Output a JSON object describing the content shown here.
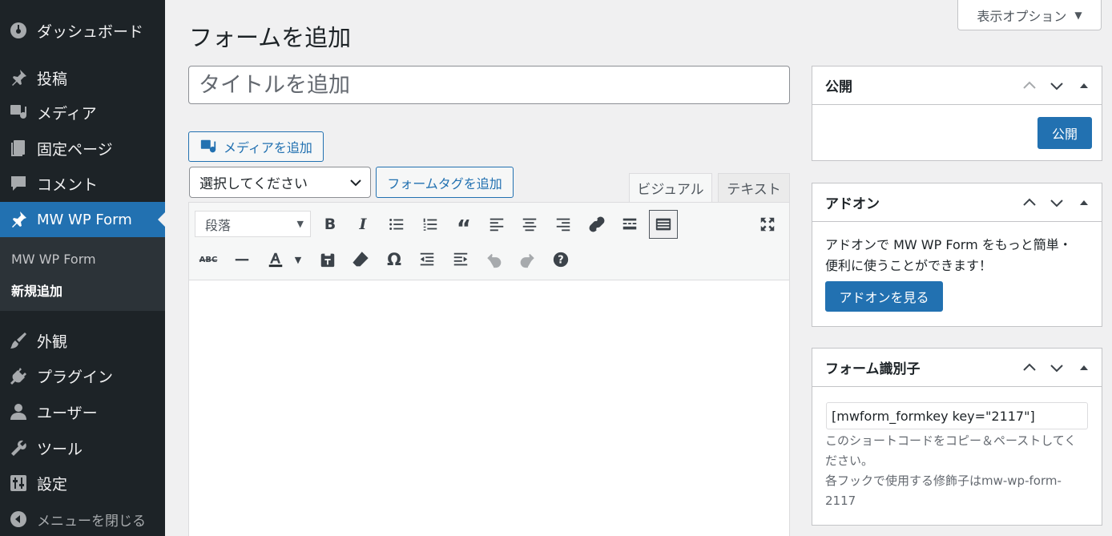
{
  "sidebar": {
    "dashboard": "ダッシュボード",
    "posts": "投稿",
    "media": "メディア",
    "pages": "固定ページ",
    "comments": "コメント",
    "mwwpform": "MW WP Form",
    "sub_list": "MW WP Form",
    "sub_new": "新規追加",
    "appearance": "外観",
    "plugins": "プラグイン",
    "users": "ユーザー",
    "tools": "ツール",
    "settings": "設定",
    "collapse": "メニューを閉じる"
  },
  "header": {
    "title": "フォームを追加",
    "screen_options": "表示オプション"
  },
  "editor": {
    "title_placeholder": "タイトルを追加",
    "add_media": "メディアを追加",
    "select_value": "選択してください",
    "add_form_tag": "フォームタグを追加",
    "tab_visual": "ビジュアル",
    "tab_text": "テキスト",
    "format_value": "段落"
  },
  "publish_box": {
    "title": "公開",
    "button": "公開"
  },
  "addon_box": {
    "title": "アドオン",
    "text_line1": "アドオンで MW WP Form をもっと簡単・",
    "text_line2": "便利に使うことができます！",
    "button": "アドオンを見る"
  },
  "form_id_box": {
    "title": "フォーム識別子",
    "shortcode": "[mwform_formkey key=\"2117\"]",
    "note_line1": "このショートコードをコピー＆ペーストしてく",
    "note_line2": "ださい。",
    "note_line3": "各フックで使用する修飾子はmw-wp-form-",
    "note_line4": "2117"
  },
  "colors": {
    "sidebar_bg": "#1d2327",
    "accent": "#2271b1",
    "page_bg": "#f0f0f1"
  }
}
